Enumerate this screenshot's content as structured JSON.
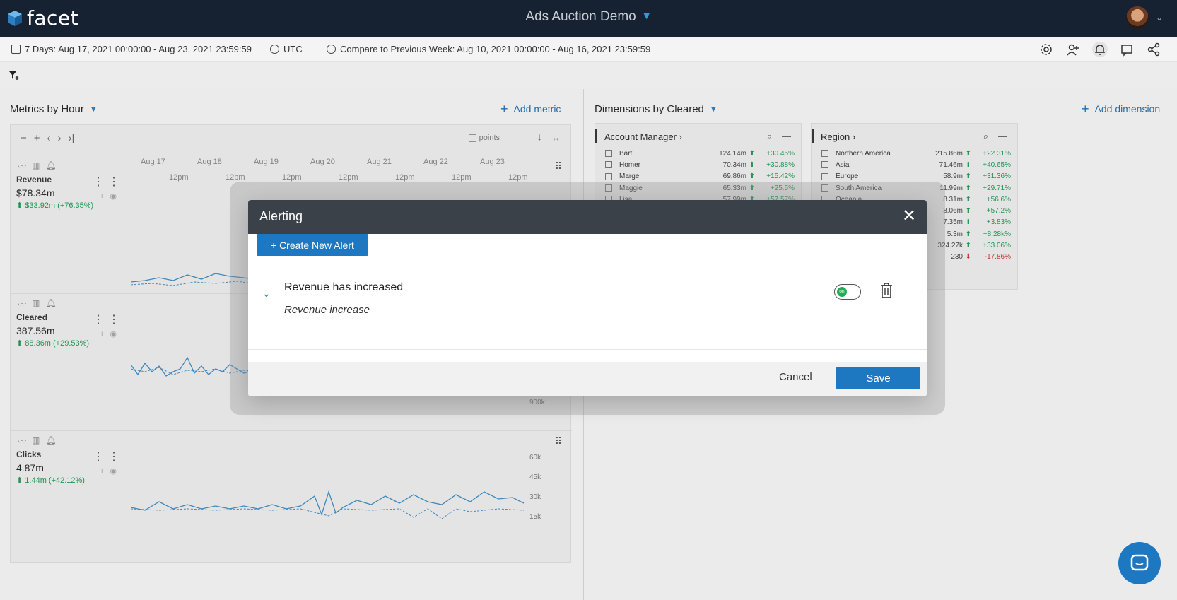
{
  "app": {
    "logo": "facet",
    "title": "Ads Auction Demo"
  },
  "range": {
    "date": "7 Days: Aug 17, 2021 00:00:00 - Aug 23, 2021 23:59:59",
    "timezone": "UTC",
    "compare": "Compare to Previous Week: Aug 10, 2021 00:00:00 - Aug 16, 2021 23:59:59"
  },
  "metrics_panel": {
    "title": "Metrics by",
    "group": "Hour",
    "add_label": "Add metric",
    "points_label": "points",
    "days": [
      "Aug 17",
      "Aug 18",
      "Aug 19",
      "Aug 20",
      "Aug 21",
      "Aug 22",
      "Aug 23"
    ],
    "hour_label": "12pm",
    "rows": [
      {
        "name": "Revenue",
        "value": "$78.34m",
        "delta": "$33.92m (+76.35%)",
        "axis": []
      },
      {
        "name": "Cleared",
        "value": "387.56m",
        "delta": "88.36m (+29.53%)",
        "axis": [
          "900k"
        ]
      },
      {
        "name": "Clicks",
        "value": "4.87m",
        "delta": "1.44m (+42.12%)",
        "axis": [
          "60k",
          "45k",
          "30k",
          "15k"
        ]
      }
    ]
  },
  "dimensions_panel": {
    "title": "Dimensions by",
    "group": "Cleared",
    "add_label": "Add dimension",
    "boxes": [
      {
        "title": "Account Manager",
        "rows": [
          {
            "label": "Bart",
            "value": "124.14m",
            "pct": "+30.45%",
            "dir": "up"
          },
          {
            "label": "Homer",
            "value": "70.34m",
            "pct": "+30.88%",
            "dir": "up"
          },
          {
            "label": "Marge",
            "value": "69.86m",
            "pct": "+15.42%",
            "dir": "up"
          },
          {
            "label": "Maggie",
            "value": "65.33m",
            "pct": "+25.5%",
            "dir": "up"
          },
          {
            "label": "Lisa",
            "value": "57.99m",
            "pct": "+57.57%",
            "dir": "up"
          }
        ]
      },
      {
        "title": "Region",
        "rows": [
          {
            "label": "Northern America",
            "value": "215.86m",
            "pct": "+22.31%",
            "dir": "up"
          },
          {
            "label": "Asia",
            "value": "71.46m",
            "pct": "+40.65%",
            "dir": "up"
          },
          {
            "label": "Europe",
            "value": "58.9m",
            "pct": "+31.36%",
            "dir": "up"
          },
          {
            "label": "South America",
            "value": "11.99m",
            "pct": "+29.71%",
            "dir": "up"
          },
          {
            "label": "Oceania",
            "value": "8.31m",
            "pct": "+56.6%",
            "dir": "up"
          },
          {
            "label": "",
            "value": "8.06m",
            "pct": "+57.2%",
            "dir": "up"
          },
          {
            "label": "",
            "value": "7.35m",
            "pct": "+3.83%",
            "dir": "up"
          },
          {
            "label": "",
            "value": "5.3m",
            "pct": "+8.28k%",
            "dir": "up"
          },
          {
            "label": "",
            "value": "324.27k",
            "pct": "+33.06%",
            "dir": "up"
          },
          {
            "label": "",
            "value": "230",
            "pct": "-17.86%",
            "dir": "down"
          }
        ]
      }
    ]
  },
  "modal": {
    "title": "Alerting",
    "create_label": "+ Create New Alert",
    "alert": {
      "title": "Revenue has increased",
      "description": "Revenue increase",
      "toggle": "on"
    },
    "cancel_label": "Cancel",
    "save_label": "Save"
  },
  "colors": {
    "topbar": "#162231",
    "accent": "#1d78c1",
    "positive": "#1a9b50",
    "negative": "#d0302f",
    "toggle_on": "#1fae55"
  }
}
